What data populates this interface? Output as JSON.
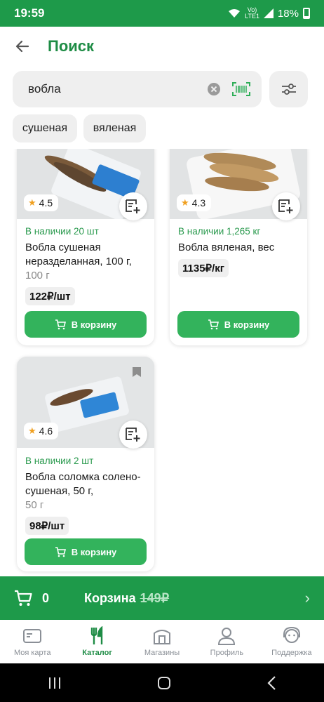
{
  "status": {
    "time": "19:59",
    "network_top": "Vo)",
    "network_bottom": "LTE1",
    "battery": "18%"
  },
  "header": {
    "title": "Поиск"
  },
  "search": {
    "value": "вобла"
  },
  "chips": [
    "сушеная",
    "вяленая"
  ],
  "products": [
    {
      "rating": "4.5",
      "stock": "В наличии 20 шт",
      "name": "Вобла сушеная неразделанная, 100 г,",
      "weight": "100 г",
      "price": "122₽/шт",
      "button": "В корзину"
    },
    {
      "rating": "4.3",
      "stock": "В наличии 1,265 кг",
      "name": "Вобла вяленая, вес",
      "weight": "",
      "price": "1135₽/кг",
      "button": "В корзину"
    },
    {
      "rating": "4.6",
      "stock": "В наличии 2 шт",
      "name": "Вобла соломка солено-сушеная, 50 г,",
      "weight": "50 г",
      "price": "98₽/шт",
      "button": "В корзину"
    }
  ],
  "cart": {
    "count": "0",
    "label": "Корзина",
    "total": "149₽"
  },
  "nav": [
    {
      "label": "Моя карта",
      "icon": "card-icon"
    },
    {
      "label": "Каталог",
      "icon": "fork-knife-icon",
      "active": true
    },
    {
      "label": "Магазины",
      "icon": "store-icon"
    },
    {
      "label": "Профиль",
      "icon": "profile-icon"
    },
    {
      "label": "Поддержка",
      "icon": "support-icon"
    }
  ],
  "colors": {
    "brand": "#1e9a4a",
    "button": "#33b35c",
    "stock": "#2a9a4e",
    "star": "#f0a020"
  }
}
